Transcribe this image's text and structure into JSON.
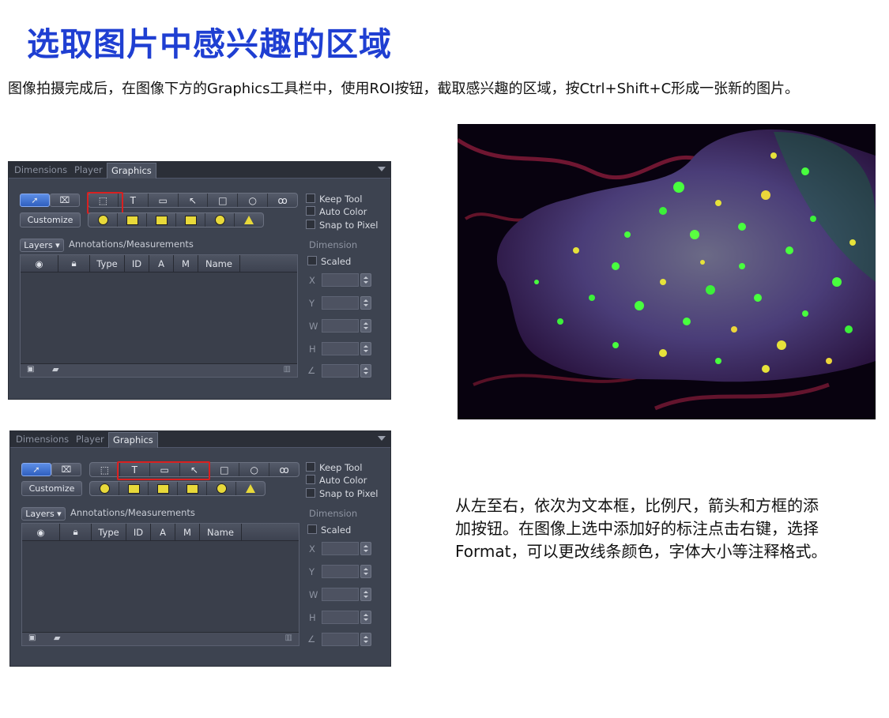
{
  "title": "选取图片中感兴趣的区域",
  "intro": "图像拍摄完成后，在图像下方的Graphics工具栏中，使用ROI按钮，截取感兴趣的区域，按Ctrl+Shift+C形成一张新的图片。",
  "description": [
    "从左至右，依次为文本框，比例尺，箭头和方框的添",
    "加按钮。在图像上选中添加好的标注点击右键，选择",
    "Format，可以更改线条颜色，字体大小等注释格式。"
  ],
  "panel": {
    "tabs": [
      "Dimensions",
      "Player",
      "Graphics"
    ],
    "active_tab": "Graphics",
    "customize_label": "Customize",
    "tool_text_glyph": "T",
    "checkboxes": [
      "Keep Tool",
      "Auto Color",
      "Snap to Pixel"
    ],
    "layers_label": "Layers ▾",
    "annotations_label": "Annotations/Measurements",
    "columns": [
      "",
      "",
      "Type",
      "ID",
      "A",
      "M",
      "Name"
    ],
    "dimension_label": "Dimension",
    "scaled_label": "Scaled",
    "fields": [
      "X",
      "Y",
      "W",
      "H",
      "∠"
    ]
  },
  "colors": {
    "title": "#1f3fd2",
    "panel_bg": "#3d4350",
    "highlight": "#d92020",
    "selected_tool": "#2f5fbf"
  },
  "image": {
    "description_icons": "fluorescence-microscopy-image"
  }
}
